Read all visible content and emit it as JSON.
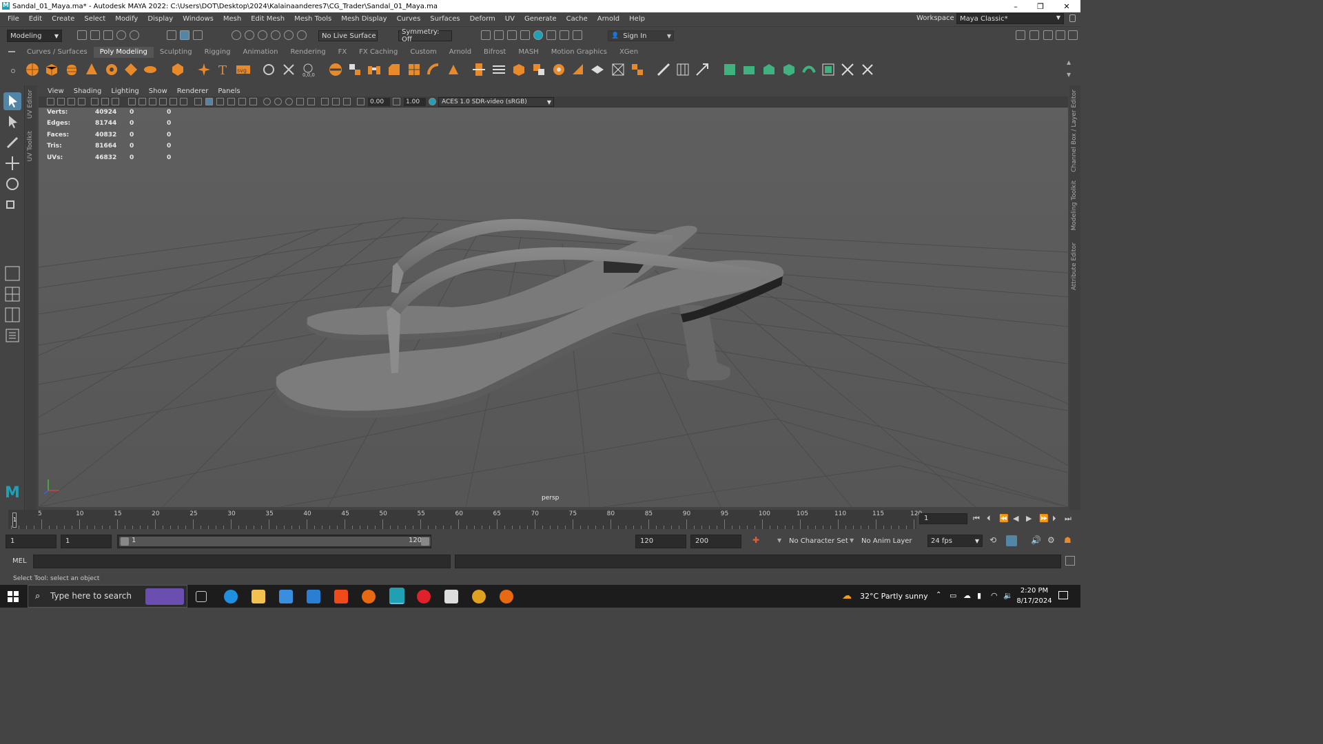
{
  "window": {
    "title": "Sandal_01_Maya.ma* - Autodesk MAYA 2022: C:\\Users\\DOT\\Desktop\\2024\\Kalainaanderes7\\CG_Trader\\Sandal_01_Maya.ma",
    "minimize": "–",
    "maximize": "❐",
    "close": "✕"
  },
  "menu": [
    "File",
    "Edit",
    "Create",
    "Select",
    "Modify",
    "Display",
    "Windows",
    "Mesh",
    "Edit Mesh",
    "Mesh Tools",
    "Mesh Display",
    "Curves",
    "Surfaces",
    "Deform",
    "UV",
    "Generate",
    "Cache",
    "Arnold",
    "Help"
  ],
  "workspace": {
    "label": "Workspace :",
    "value": "Maya Classic*"
  },
  "toolbar": {
    "menuset": "Modeling",
    "live_surface": "No Live Surface",
    "symmetry": "Symmetry: Off",
    "sign_in": "Sign In"
  },
  "shelf_tabs": [
    "Curves / Surfaces",
    "Poly Modeling",
    "Sculpting",
    "Rigging",
    "Animation",
    "Rendering",
    "FX",
    "FX Caching",
    "Custom",
    "Arnold",
    "Bifrost",
    "MASH",
    "Motion Graphics",
    "XGen"
  ],
  "shelf_active": "Poly Modeling",
  "side_tabs": {
    "left": [
      "UV Editor",
      "UV Toolkit"
    ],
    "right": [
      "Channel Box / Layer Editor",
      "Modeling Toolkit",
      "Attribute Editor"
    ]
  },
  "panel_menu": [
    "View",
    "Shading",
    "Lighting",
    "Show",
    "Renderer",
    "Panels"
  ],
  "panel_tools": {
    "exposure": "0.00",
    "gamma": "1.00",
    "color_space": "ACES 1.0 SDR-video (sRGB)"
  },
  "hud": [
    {
      "label": "Verts:",
      "v1": "40924",
      "v2": "0",
      "v3": "0"
    },
    {
      "label": "Edges:",
      "v1": "81744",
      "v2": "0",
      "v3": "0"
    },
    {
      "label": "Faces:",
      "v1": "40832",
      "v2": "0",
      "v3": "0"
    },
    {
      "label": "Tris:",
      "v1": "81664",
      "v2": "0",
      "v3": "0"
    },
    {
      "label": "UVs:",
      "v1": "46832",
      "v2": "0",
      "v3": "0"
    }
  ],
  "camera": "persp",
  "timeline": {
    "ticks": [
      "5",
      "10",
      "15",
      "20",
      "25",
      "30",
      "35",
      "40",
      "45",
      "50",
      "55",
      "60",
      "65",
      "70",
      "75",
      "80",
      "85",
      "90",
      "95",
      "100",
      "105",
      "110",
      "115",
      "120"
    ],
    "current_frame": "1",
    "current_marker": "1"
  },
  "range": {
    "start": "1",
    "anim_start": "1",
    "slider_start": "1",
    "slider_end": "120",
    "end": "120",
    "anim_end": "200",
    "character_set": "No Character Set",
    "anim_layer": "No Anim Layer",
    "fps": "24 fps"
  },
  "command_line": {
    "label": "MEL"
  },
  "help_line": "Select Tool: select an object",
  "taskbar": {
    "search": "Type here to search",
    "weather": "32°C  Partly sunny",
    "time": "2:20 PM",
    "date": "8/17/2024"
  },
  "colors": {
    "viewport_bg": "#5d5d5d",
    "grid": "#4a4a4a",
    "mesh": "#7c7c7c",
    "maya_logo": "#1fa0b4"
  }
}
